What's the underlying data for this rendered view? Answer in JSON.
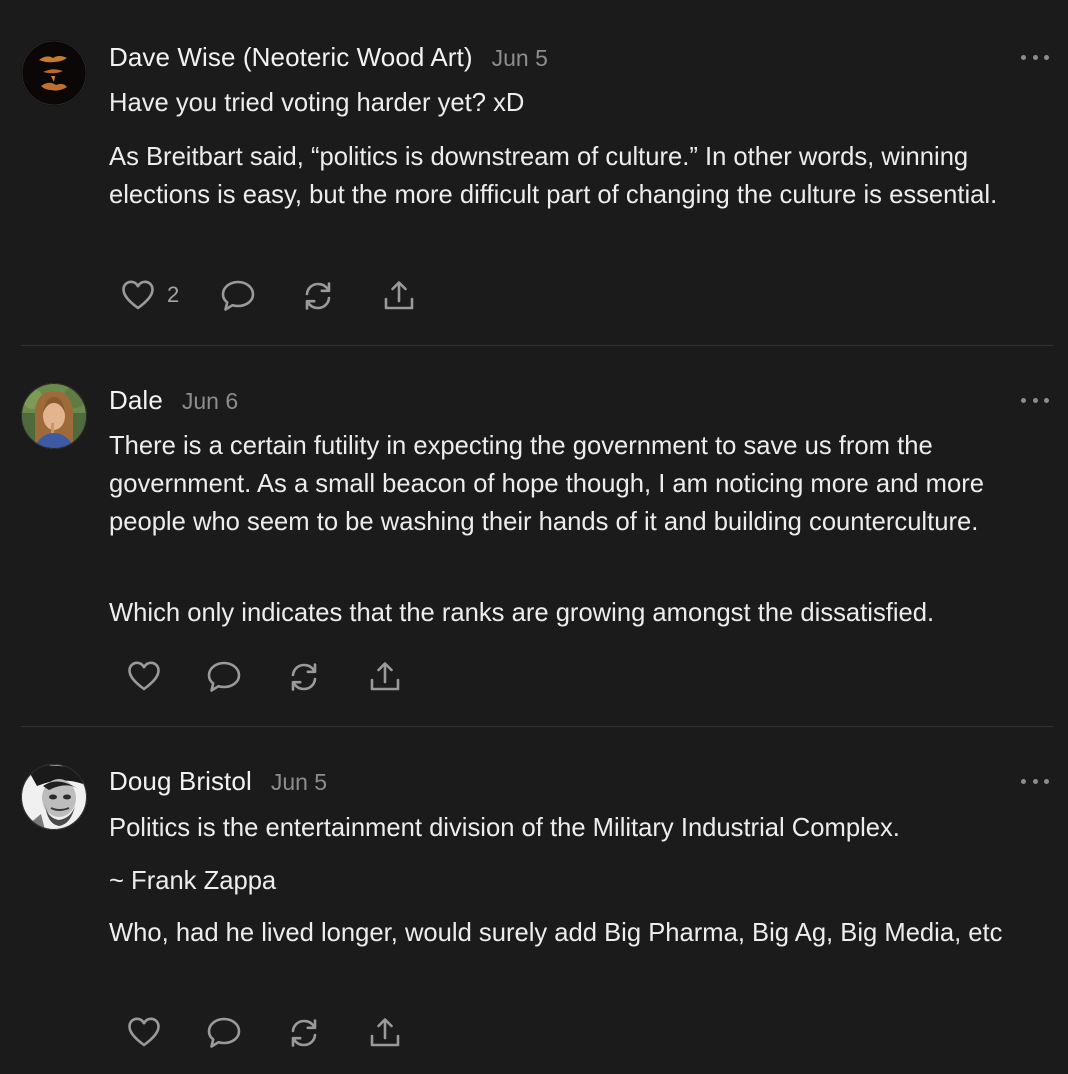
{
  "comments": [
    {
      "author": "Dave Wise (Neoteric Wood Art)",
      "date": "Jun 5",
      "paragraphs": [
        "Have you tried voting harder yet? xD",
        "As Breitbart said, “politics is downstream of culture.” In other words, winning elections is easy, but the more difficult part of changing the culture is essential."
      ],
      "like_count": "2"
    },
    {
      "author": "Dale",
      "date": "Jun 6",
      "paragraphs": [
        "There is a certain futility in expecting the government to save us from the government. As a small beacon of hope though, I am noticing more and more people who seem to be washing their hands of it and building counterculture.",
        "Which only indicates that the ranks are growing amongst the dissatisfied."
      ],
      "like_count": ""
    },
    {
      "author": "Doug Bristol",
      "date": "Jun 5",
      "paragraphs": [
        "Politics is the entertainment division of the Military Industrial Complex.",
        "~ Frank Zappa",
        "Who, had he lived longer, would surely add Big Pharma, Big Ag, Big Media, etc"
      ],
      "like_count": ""
    }
  ],
  "icons": {
    "like": "heart-icon",
    "reply": "speech-bubble-icon",
    "restack": "refresh-arrows-icon",
    "share": "share-upload-icon",
    "more": "ellipsis-icon"
  },
  "colors": {
    "background": "#1b1b1c",
    "text": "#ececec",
    "muted": "#8d8d90",
    "divider": "#333336"
  }
}
